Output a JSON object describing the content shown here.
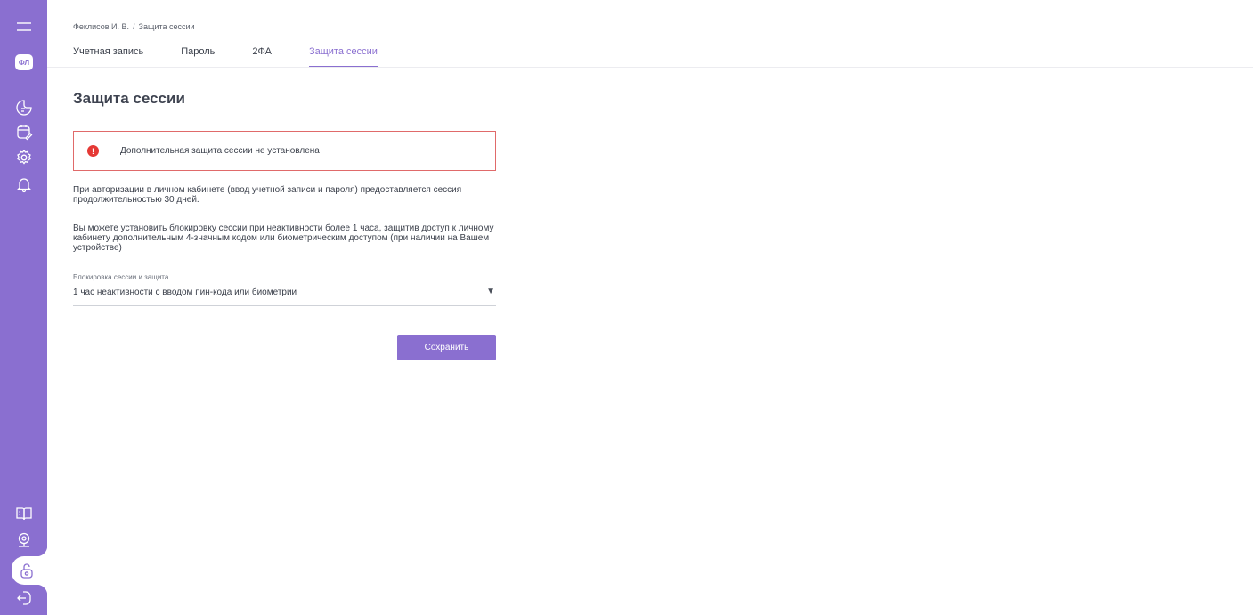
{
  "breadcrumb": {
    "user": "Феклисов И. В.",
    "separator": "/",
    "current": "Защита сессии"
  },
  "tabs": [
    {
      "label": "Учетная запись",
      "active": false
    },
    {
      "label": "Пароль",
      "active": false
    },
    {
      "label": "2ФА",
      "active": false
    },
    {
      "label": "Защита сессии",
      "active": true
    }
  ],
  "sidebar": {
    "avatar": "ФЛ",
    "top_icons": [
      "menu-icon",
      "avatar",
      "document-icon",
      "calendar-edit-icon",
      "settings-icon",
      "bell-icon"
    ],
    "bottom_icons": [
      "book-icon",
      "presentation-icon",
      "lock-icon",
      "logout-icon"
    ],
    "active_item": "lock-icon"
  },
  "page": {
    "title": "Защита сессии",
    "alert": "Дополнительная защита сессии не установлена",
    "paragraph1": "При авторизации в личном кабинете (ввод учетной записи и пароля) предоставляется сессия продолжительностью 30 дней.",
    "paragraph2": "Вы можете установить блокировку сессии при неактивности более 1 часа, защитив доступ к личному кабинету дополнительным 4-значным кодом или биометрическим доступом (при наличии на Вашем устройстве)",
    "select_label": "Блокировка сессии и защита",
    "select_value": "1 час неактивности с вводом пин-кода или биометрии",
    "save_label": "Сохранить"
  },
  "colors": {
    "accent": "#8a6fd0",
    "alert_border": "#e06a6a",
    "alert_icon": "#e53935"
  }
}
